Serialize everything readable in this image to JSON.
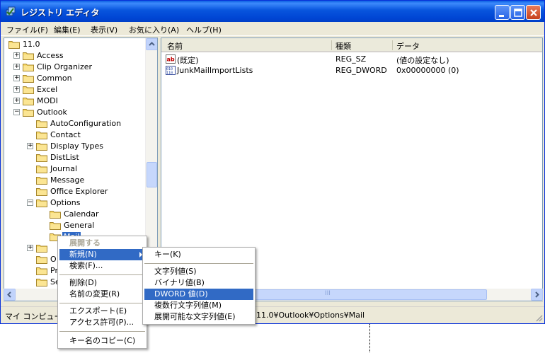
{
  "window": {
    "title": "レジストリ エディタ"
  },
  "menubar": [
    "ファイル(F)",
    "編集(E)",
    "表示(V)",
    "お気に入り(A)",
    "ヘルプ(H)"
  ],
  "tree": {
    "items": [
      {
        "label": "11.0",
        "expander": ""
      },
      {
        "label": "Access",
        "expander": "+"
      },
      {
        "label": "Clip Organizer",
        "expander": "+"
      },
      {
        "label": "Common",
        "expander": "+"
      },
      {
        "label": "Excel",
        "expander": "+"
      },
      {
        "label": "MODI",
        "expander": "+"
      },
      {
        "label": "Outlook",
        "expander": "−"
      },
      {
        "label": "AutoConfiguration",
        "expander": ""
      },
      {
        "label": "Contact",
        "expander": ""
      },
      {
        "label": "Display Types",
        "expander": "+"
      },
      {
        "label": "DistList",
        "expander": ""
      },
      {
        "label": "Journal",
        "expander": ""
      },
      {
        "label": "Message",
        "expander": ""
      },
      {
        "label": "Office Explorer",
        "expander": ""
      },
      {
        "label": "Options",
        "expander": "−"
      },
      {
        "label": "Calendar",
        "expander": ""
      },
      {
        "label": "General",
        "expander": ""
      },
      {
        "label": "Mail",
        "expander": ""
      },
      {
        "label": "",
        "expander": "+"
      },
      {
        "label": "O",
        "expander": ""
      },
      {
        "label": "Pr",
        "expander": ""
      },
      {
        "label": "Se",
        "expander": ""
      }
    ]
  },
  "list": {
    "columns": [
      "名前",
      "種類",
      "データ"
    ],
    "rows": [
      {
        "name": "(既定)",
        "type": "REG_SZ",
        "data": "(値の設定なし)",
        "icon": "string-value-icon"
      },
      {
        "name": "JunkMailImportLists",
        "type": "REG_DWORD",
        "data": "0x00000000 (0)",
        "icon": "binary-value-icon"
      }
    ]
  },
  "status": {
    "prefix": "マイ コンピュータ",
    "path": "11.0¥Outlook¥Options¥Mail"
  },
  "context_menu": {
    "items": [
      "展開する",
      "新規(N)",
      "検索(F)...",
      "削除(D)",
      "名前の変更(R)",
      "エクスポート(E)",
      "アクセス許可(P)...",
      "キー名のコピー(C)"
    ]
  },
  "submenu": {
    "items": [
      "キー(K)",
      "文字列値(S)",
      "バイナリ値(B)",
      "DWORD 値(D)",
      "複数行文字列値(M)",
      "展開可能な文字列値(E)"
    ]
  },
  "hscroll_label": "III"
}
